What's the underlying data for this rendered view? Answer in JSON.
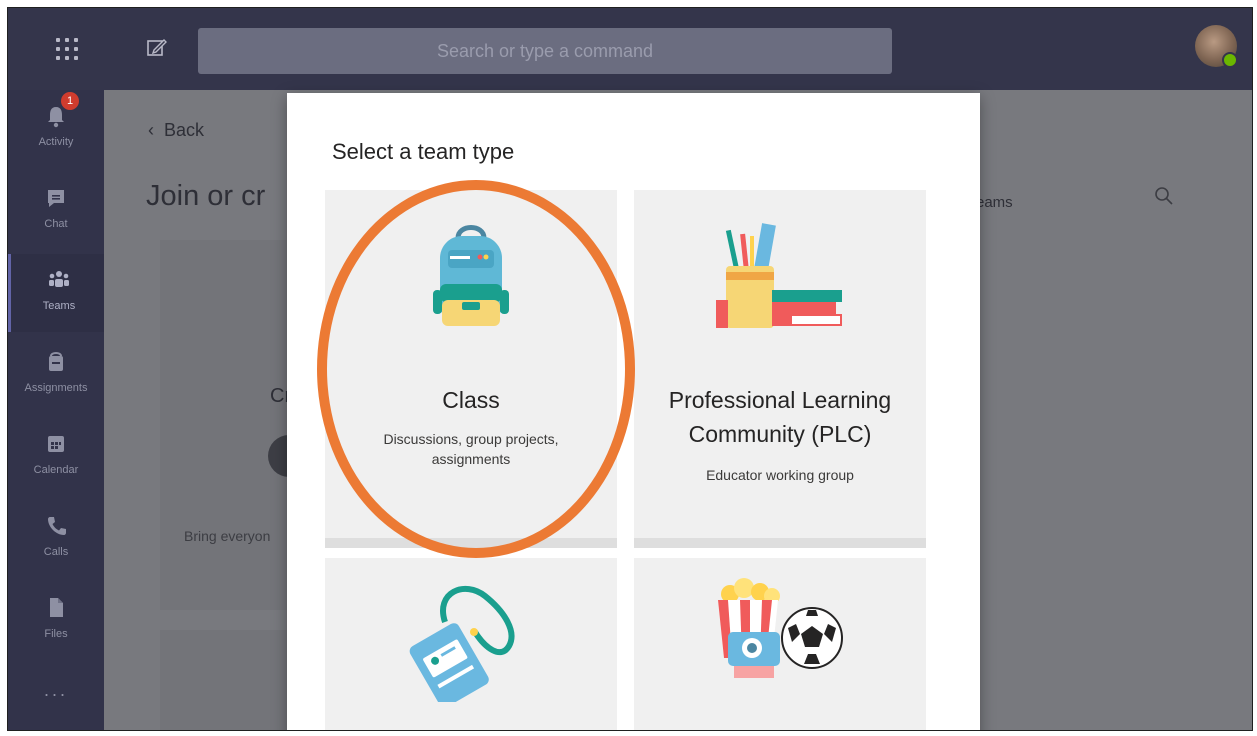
{
  "search": {
    "placeholder": "Search or type a command"
  },
  "rail": {
    "items": [
      {
        "label": "Activity",
        "icon": "bell-icon",
        "badge": "1"
      },
      {
        "label": "Chat",
        "icon": "chat-icon"
      },
      {
        "label": "Teams",
        "icon": "teams-icon"
      },
      {
        "label": "Assignments",
        "icon": "assignments-icon"
      },
      {
        "label": "Calendar",
        "icon": "calendar-icon"
      },
      {
        "label": "Calls",
        "icon": "phone-icon"
      },
      {
        "label": "Files",
        "icon": "file-icon"
      }
    ],
    "more": "..."
  },
  "background": {
    "back": "Back",
    "title": "Join or cr",
    "search_text": "eams",
    "card_title": "Cr",
    "card_text": "Bring everyon"
  },
  "modal": {
    "title": "Select a team type",
    "tiles": [
      {
        "name": "Class",
        "description": "Discussions, group projects, assignments",
        "icon": "backpack-icon"
      },
      {
        "name": "Professional Learning Community (PLC)",
        "description": "Educator working group",
        "icon": "pencil-cup-icon"
      },
      {
        "name": "",
        "description": "",
        "icon": "lanyard-badge-icon"
      },
      {
        "name": "",
        "description": "",
        "icon": "popcorn-soccer-icon"
      }
    ]
  },
  "colors": {
    "accent": "#6264a7",
    "highlight": "#ec7a34",
    "rail": "#32334a",
    "topbar": "#34354b"
  }
}
